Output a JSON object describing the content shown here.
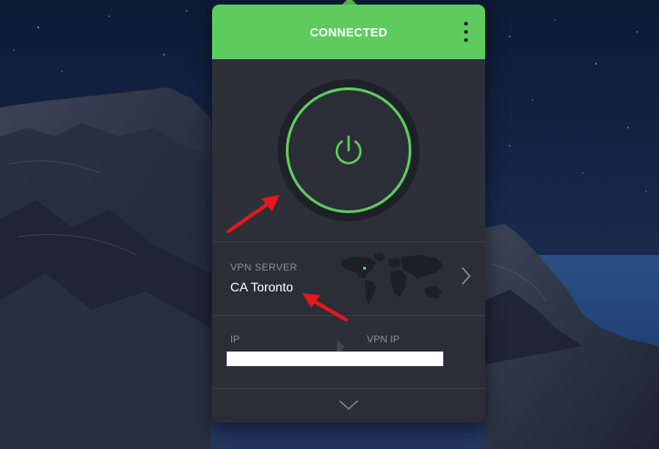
{
  "status": {
    "text": "CONNECTED",
    "color": "#5ecb5e"
  },
  "menu": {
    "icon": "kebab-menu-icon"
  },
  "power": {
    "icon": "power-icon",
    "state": "on",
    "color": "#5ecb5e"
  },
  "server": {
    "label": "VPN SERVER",
    "name": "CA Toronto",
    "map_icon": "world-map-icon",
    "chevron_icon": "chevron-right-icon"
  },
  "ip": {
    "ip_label": "IP",
    "vpn_ip_label": "VPN IP",
    "arrow_icon": "arrow-right-icon"
  },
  "footer": {
    "expand_icon": "chevron-down-icon"
  },
  "annotations": {
    "arrow_color": "#e8161a"
  }
}
